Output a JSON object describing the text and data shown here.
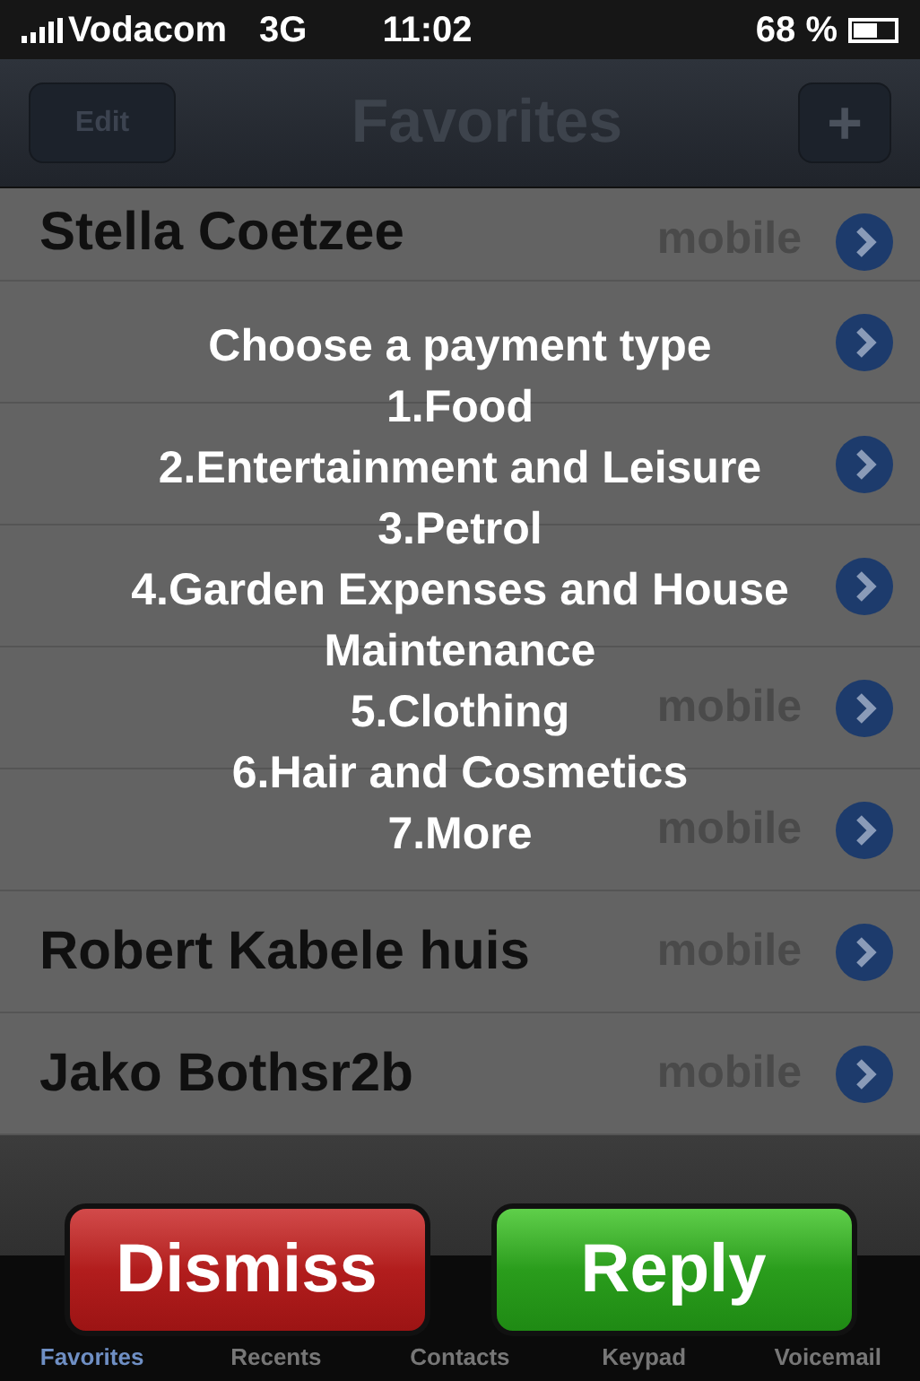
{
  "status_bar": {
    "carrier": "Vodacom",
    "network": "3G",
    "time": "11:02",
    "battery": "68 %"
  },
  "nav_bar": {
    "left_button": "Edit",
    "title": "Favorites",
    "right_button": "+"
  },
  "favorites": [
    {
      "kind": "contact",
      "name": "Stella Coetzee",
      "label": "mobile"
    },
    {
      "kind": "hidden"
    },
    {
      "kind": "hidden"
    },
    {
      "kind": "hidden"
    },
    {
      "kind": "label_only",
      "label": "mobile"
    },
    {
      "kind": "label_only",
      "label": "mobile"
    },
    {
      "kind": "contact",
      "name": "Robert Kabele huis",
      "label": "mobile"
    },
    {
      "kind": "contact",
      "name": "Jako Bothsr2b",
      "label": "mobile"
    }
  ],
  "alert": {
    "message": [
      "Choose a payment type",
      "1.Food",
      "2.Entertainment and Leisure",
      "3.Petrol",
      "4.Garden Expenses and House Maintenance",
      "5.Clothing",
      "6.Hair and Cosmetics",
      "7.More"
    ],
    "buttons": [
      {
        "label": "Dismiss",
        "kind": "cancel"
      },
      {
        "label": "Reply",
        "kind": "default"
      }
    ]
  },
  "tab_bar": [
    {
      "label": "Favorites",
      "selected": true
    },
    {
      "label": "Recents",
      "selected": false
    },
    {
      "label": "Contacts",
      "selected": false
    },
    {
      "label": "Keypad",
      "selected": false
    },
    {
      "label": "Voicemail",
      "selected": false
    }
  ]
}
